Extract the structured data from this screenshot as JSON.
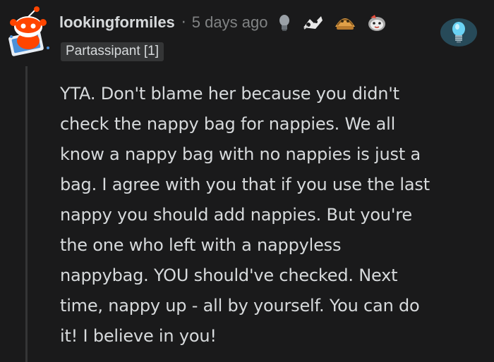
{
  "comment": {
    "author": "lookingformiles",
    "separator": "·",
    "timestamp": "5 days ago",
    "flair": "Partassipant [1]",
    "awards": [
      "bulb-award-icon",
      "rocket-like-award-icon",
      "taco-award-icon",
      "wholesome-seal-award-icon"
    ],
    "side_award": "lightbulb-award-icon",
    "body_lines": [
      "YTA. Don't blame her because you didn't",
      "check the nappy bag for nappies. We all",
      "know a nappy bag with no nappies is just a",
      "bag. I agree with you that if you use the last",
      "nappy you should add nappies. But you're",
      "the one who left with a nappyless",
      "nappybag. YOU should've checked. Next",
      "time, nappy up - all by yourself. You can do",
      "it! I believe in you!"
    ]
  },
  "colors": {
    "background": "#1a1a1b",
    "text": "#d7dadc",
    "muted": "#818384",
    "flair_bg": "#343536",
    "snoo_red": "#ff4500"
  }
}
